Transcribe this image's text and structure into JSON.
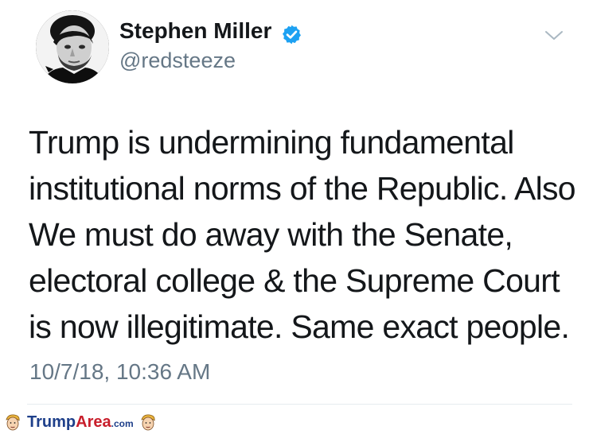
{
  "tweet": {
    "author": {
      "display_name": "Stephen Miller",
      "handle": "@redsteeze",
      "verified": true,
      "avatar_icon": "person-avatar"
    },
    "menu_icon": "chevron-down-icon",
    "text_lines": [
      "Trump is undermining fundamental",
      "institutional norms of the Republic. Also",
      "We must do away with the Senate,",
      "electoral college & the Supreme Court",
      "is now illegitimate. Same exact people."
    ],
    "timestamp": "10/7/18, 10:36 AM"
  },
  "watermark": {
    "brand_part1": "Trump",
    "brand_part2": "Area",
    "brand_suffix": ".com",
    "icon": "cartoon-face-icon"
  },
  "colors": {
    "text_primary": "#14171a",
    "text_secondary": "#657786",
    "verified_blue": "#1da1f2",
    "divider": "#e6ecf0",
    "brand_blue": "#1e3f8a",
    "brand_red": "#c81e2b"
  }
}
